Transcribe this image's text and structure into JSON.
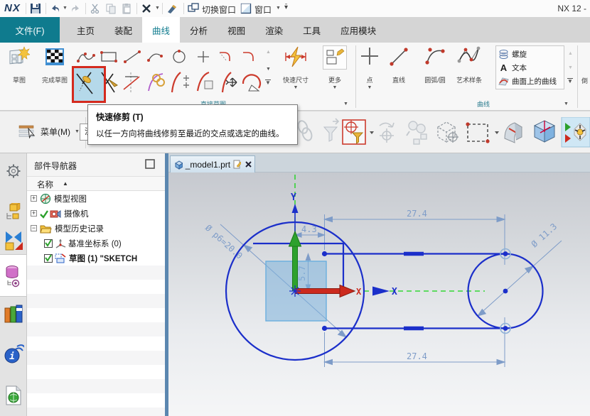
{
  "titlebar": {
    "logo": "NX",
    "switch_window": "切换窗口",
    "window": "窗口",
    "right": "NX 12 -"
  },
  "tabs": {
    "file": "文件(F)",
    "items": [
      "主页",
      "装配",
      "曲线",
      "分析",
      "视图",
      "渲染",
      "工具",
      "应用模块"
    ],
    "active": "曲线"
  },
  "ribbon": {
    "sketch": "草图",
    "finish_sketch": "完成草图",
    "group_direct_sketch": "直接草图",
    "rapid_dim": "快速尺寸",
    "more": "更多",
    "point": "点",
    "line": "直线",
    "arc_circle": "圆弧/圆",
    "studio_spline": "艺术样条",
    "helix": "螺旋",
    "text": "文本",
    "curve_on_surface": "曲面上的曲线",
    "group_curve": "曲线",
    "partial_right": "倒"
  },
  "menubar": {
    "menu": "菜单(M)",
    "filter": "没有选择过滤器"
  },
  "tooltip": {
    "title": "快速修剪 (T)",
    "desc": "以任一方向将曲线修剪至最近的交点或选定的曲线。"
  },
  "navigator": {
    "title": "部件导航器",
    "col_name": "名称",
    "items": [
      {
        "label": "模型视图"
      },
      {
        "label": "摄像机"
      },
      {
        "label": "模型历史记录"
      },
      {
        "label": "基准坐标系 (0)"
      },
      {
        "label": "草图 (1) \"SKETCH"
      }
    ]
  },
  "viewport": {
    "tab": "_model1.prt",
    "axis_y": "Y",
    "axis_x_red": "X",
    "axis_x_blue": "X",
    "dims": {
      "top_width": "27.4",
      "bottom_width": "27.4",
      "offset_x": "4.3",
      "offset_y": "5.7",
      "big_diameter": "Ø p6=20.0",
      "small_diameter": "Ø 11.3"
    }
  },
  "colors": {
    "accent_teal": "#0f7b8e",
    "highlight_red": "#d42a1e",
    "selection_fill": "#b5d9ea",
    "geometry_blue": "#1b2fca",
    "dimension_blue": "#7e9cc8",
    "axis_green": "#21c421",
    "axis_red": "#cc2a1e"
  }
}
